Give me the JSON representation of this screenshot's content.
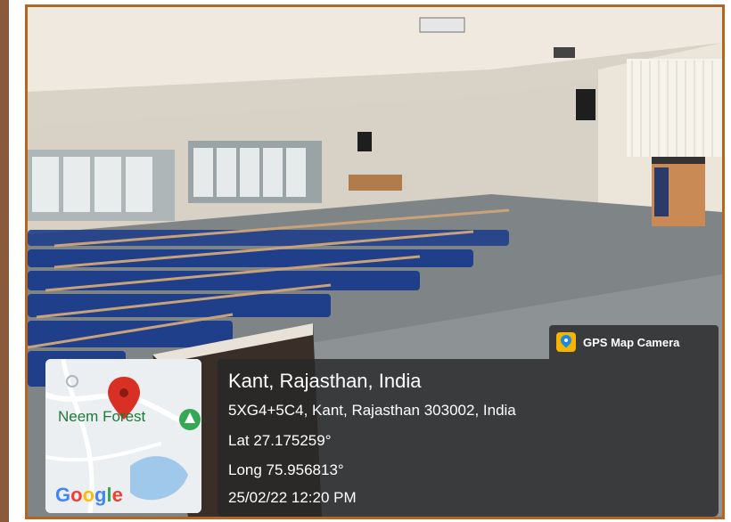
{
  "overlay": {
    "app_name": "GPS Map Camera",
    "location_title": "Kant, Rajasthan, India",
    "address": "5XG4+5C4, Kant, Rajasthan 303002, India",
    "latitude": "Lat 27.175259°",
    "longitude": "Long 75.956813°",
    "timestamp": "25/02/22 12:20 PM"
  },
  "map": {
    "place_label": "Neem Forest",
    "logo_letters": [
      "G",
      "o",
      "o",
      "g",
      "l",
      "e"
    ]
  },
  "colors": {
    "frame_border": "#b5651d",
    "chair_blue": "#1f3f8a",
    "panel_bg": "rgba(40,40,40,0.82)",
    "pin_red": "#d93025"
  }
}
